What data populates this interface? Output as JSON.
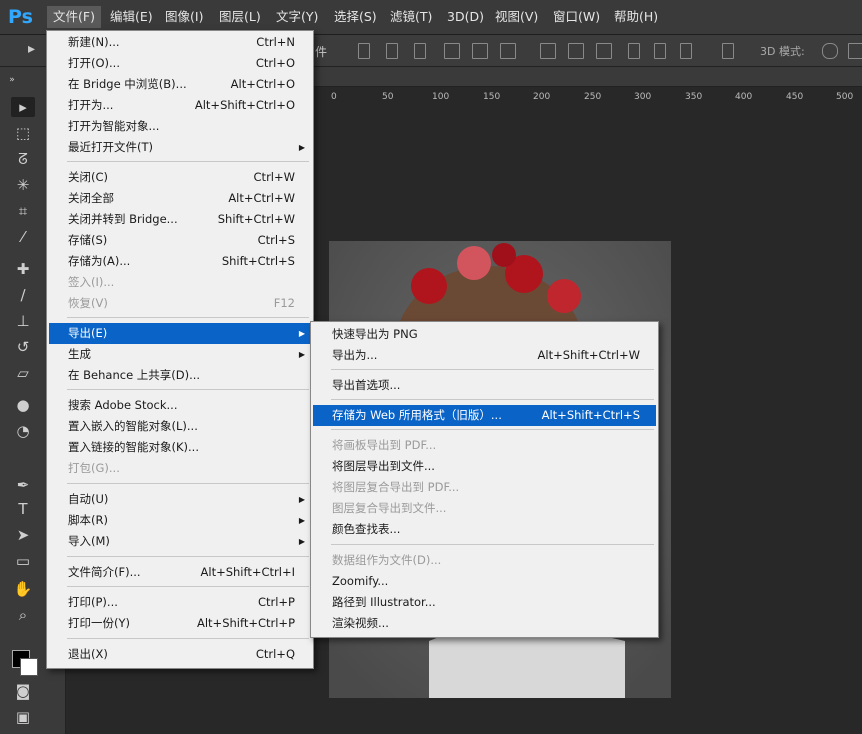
{
  "app": {
    "logo": "Ps"
  },
  "menubar": {
    "items": [
      "文件(F)",
      "编辑(E)",
      "图像(I)",
      "图层(L)",
      "文字(Y)",
      "选择(S)",
      "滤镜(T)",
      "3D(D)",
      "视图(V)",
      "窗口(W)",
      "帮助(H)"
    ]
  },
  "options_bar": {
    "partial_label": "件",
    "mode_3d": "3D 模式:"
  },
  "ruler": {
    "ticks": [
      "0",
      "50",
      "100",
      "150",
      "200",
      "250",
      "300",
      "350",
      "400",
      "450",
      "500"
    ]
  },
  "file_menu": {
    "items": [
      {
        "label": "新建(N)...",
        "shortcut": "Ctrl+N"
      },
      {
        "label": "打开(O)...",
        "shortcut": "Ctrl+O"
      },
      {
        "label": "在 Bridge 中浏览(B)...",
        "shortcut": "Alt+Ctrl+O"
      },
      {
        "label": "打开为...",
        "shortcut": "Alt+Shift+Ctrl+O"
      },
      {
        "label": "打开为智能对象...",
        "shortcut": ""
      },
      {
        "label": "最近打开文件(T)",
        "shortcut": ""
      },
      {
        "label": "关闭(C)",
        "shortcut": "Ctrl+W"
      },
      {
        "label": "关闭全部",
        "shortcut": "Alt+Ctrl+W"
      },
      {
        "label": "关闭并转到 Bridge...",
        "shortcut": "Shift+Ctrl+W"
      },
      {
        "label": "存储(S)",
        "shortcut": "Ctrl+S"
      },
      {
        "label": "存储为(A)...",
        "shortcut": "Shift+Ctrl+S"
      },
      {
        "label": "签入(I)...",
        "shortcut": ""
      },
      {
        "label": "恢复(V)",
        "shortcut": "F12"
      },
      {
        "label": "导出(E)",
        "shortcut": ""
      },
      {
        "label": "生成",
        "shortcut": ""
      },
      {
        "label": "在 Behance 上共享(D)...",
        "shortcut": ""
      },
      {
        "label": "搜索 Adobe Stock...",
        "shortcut": ""
      },
      {
        "label": "置入嵌入的智能对象(L)...",
        "shortcut": ""
      },
      {
        "label": "置入链接的智能对象(K)...",
        "shortcut": ""
      },
      {
        "label": "打包(G)...",
        "shortcut": ""
      },
      {
        "label": "自动(U)",
        "shortcut": ""
      },
      {
        "label": "脚本(R)",
        "shortcut": ""
      },
      {
        "label": "导入(M)",
        "shortcut": ""
      },
      {
        "label": "文件简介(F)...",
        "shortcut": "Alt+Shift+Ctrl+I"
      },
      {
        "label": "打印(P)...",
        "shortcut": "Ctrl+P"
      },
      {
        "label": "打印一份(Y)",
        "shortcut": "Alt+Shift+Ctrl+P"
      },
      {
        "label": "退出(X)",
        "shortcut": "Ctrl+Q"
      }
    ]
  },
  "export_submenu": {
    "items": [
      {
        "label": "快速导出为 PNG",
        "shortcut": ""
      },
      {
        "label": "导出为...",
        "shortcut": "Alt+Shift+Ctrl+W"
      },
      {
        "label": "导出首选项...",
        "shortcut": ""
      },
      {
        "label": "存储为 Web 所用格式（旧版）...",
        "shortcut": "Alt+Shift+Ctrl+S"
      },
      {
        "label": "将画板导出到 PDF...",
        "shortcut": ""
      },
      {
        "label": "将图层导出到文件...",
        "shortcut": ""
      },
      {
        "label": "将图层复合导出到 PDF...",
        "shortcut": ""
      },
      {
        "label": "图层复合导出到文件...",
        "shortcut": ""
      },
      {
        "label": "颜色查找表...",
        "shortcut": ""
      },
      {
        "label": "数据组作为文件(D)...",
        "shortcut": ""
      },
      {
        "label": "Zoomify...",
        "shortcut": ""
      },
      {
        "label": "路径到 Illustrator...",
        "shortcut": ""
      },
      {
        "label": "渲染视频...",
        "shortcut": ""
      }
    ]
  },
  "colors": {
    "highlight": "#0a64c8",
    "menu_bg": "#f0f0f0",
    "app_bg": "#282828"
  }
}
